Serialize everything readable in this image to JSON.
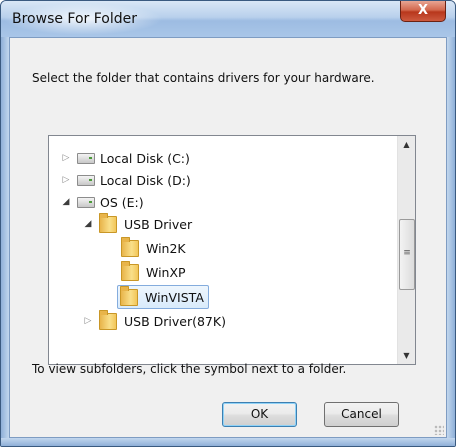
{
  "window": {
    "title": "Browse For Folder",
    "close_label": "X"
  },
  "dialog": {
    "instruction": "Select the folder that contains drivers for your hardware.",
    "hint": "To view subfolders, click the symbol next to a folder."
  },
  "tree": {
    "items": [
      {
        "label": "Local Disk (C:)",
        "type": "drive",
        "expander": "▷",
        "level": 1
      },
      {
        "label": "Local Disk (D:)",
        "type": "drive",
        "expander": "▷",
        "level": 1
      },
      {
        "label": "OS (E:)",
        "type": "drive",
        "expander": "◢",
        "level": 1
      },
      {
        "label": "USB Driver",
        "type": "folder",
        "expander": "◢",
        "level": 2
      },
      {
        "label": "Win2K",
        "type": "folder",
        "expander": "",
        "level": 3
      },
      {
        "label": "WinXP",
        "type": "folder",
        "expander": "",
        "level": 3
      },
      {
        "label": "WinVISTA",
        "type": "folder",
        "expander": "",
        "level": 3,
        "selected": true
      },
      {
        "label": "USB Driver(87K)",
        "type": "folder",
        "expander": "▷",
        "level": 2
      }
    ]
  },
  "scrollbar": {
    "up_arrow": "▲",
    "down_arrow": "▼",
    "thumb_grip": "≡"
  },
  "buttons": {
    "ok_label": "OK",
    "cancel_label": "Cancel"
  }
}
